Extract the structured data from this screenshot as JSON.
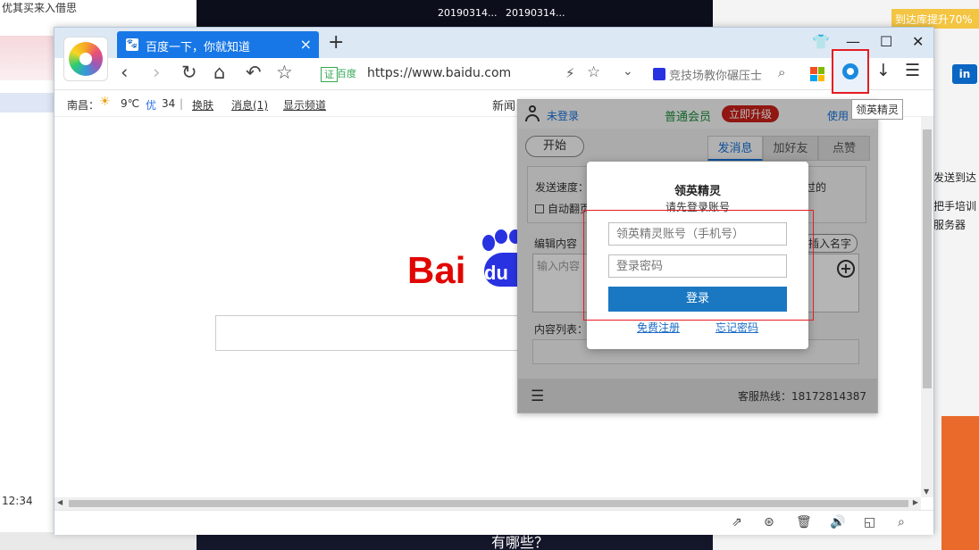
{
  "desktop": {
    "left_top_text": "优其买来入借思",
    "time": "12:34",
    "dark_labels": [
      "20190314...",
      "20190314..."
    ],
    "banner": "到达库提升70%",
    "right_news": [
      "发送到达",
      "把手培训",
      "服务器"
    ],
    "bottom_text": "有哪些？"
  },
  "browser": {
    "tab": {
      "title": "百度一下，你就知道",
      "close": "×"
    },
    "new_tab": "+",
    "window_controls": {
      "skin": "👕",
      "minimize": "—",
      "maximize": "☐",
      "close": "✕"
    },
    "nav": {
      "back": "‹",
      "forward": "›",
      "reload": "↻",
      "home": "⌂",
      "undo": "↶",
      "favorite": "☆"
    },
    "address": {
      "cert_label": "证",
      "site_label": "百度",
      "url": "https://www.baidu.com",
      "bolt": "⚡",
      "star": "☆",
      "dropdown": "⌄"
    },
    "search": {
      "placeholder": "竞技场教你碾压士",
      "icon": "⌕"
    },
    "extension_tooltip": "领英精灵",
    "download": "↓",
    "menu": "☰"
  },
  "infobar": {
    "city": "南昌：",
    "temp": "9℃",
    "aqi_label": "优",
    "aqi_value": "34",
    "separator": "|",
    "skin_link": "换肤",
    "msg_link": "消息(1)",
    "channel_link": "显示频道",
    "news": "新闻"
  },
  "page": {
    "logo_left": "Bai",
    "logo_right": "du"
  },
  "panel": {
    "not_logged_in": "未登录",
    "member": "普通会员",
    "upgrade": "立即升级",
    "use": "使用",
    "start": "开始",
    "tabs": [
      "发消息",
      "加好友",
      "点赞"
    ],
    "speed_label": "发送速度：",
    "auto_turn": "自动翻页",
    "right_hint": "过的",
    "edit_content": "编辑内容",
    "insert_name": "插入名字",
    "input_placeholder": "输入内容",
    "plus": "+",
    "content_list": "内容列表：",
    "hotline": "客服热线：18172814387"
  },
  "modal": {
    "title": "领英精灵",
    "subtitle": "请先登录账号",
    "account_placeholder": "领英精灵账号（手机号）",
    "password_placeholder": "登录密码",
    "login": "登录",
    "register": "免费注册",
    "forgot": "忘记密码"
  },
  "statusbar": {
    "icons": [
      "rocket-icon",
      "speed-icon",
      "trash-icon",
      "sound-icon",
      "window-icon",
      "search-icon"
    ],
    "glyphs": [
      "⇗",
      "⊛",
      "🗑",
      "🔊",
      "◱",
      "⌕"
    ]
  },
  "colors": {
    "tab_blue": "#1877e6",
    "highlight_red": "#e51c23",
    "login_button": "#1a78c2",
    "baidu_red": "#e10602",
    "baidu_blue": "#2932e1"
  }
}
